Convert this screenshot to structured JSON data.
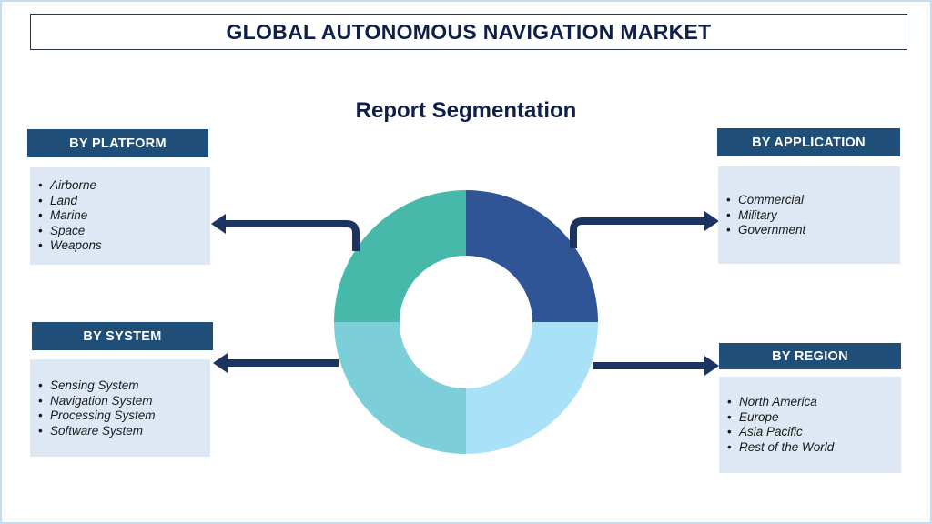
{
  "title": "GLOBAL AUTONOMOUS NAVIGATION MARKET",
  "subtitle": "Report Segmentation",
  "colors": {
    "header_bg": "#1f4e79",
    "box_bg": "#dde8f4",
    "arrow": "#1c3461",
    "title_text": "#0f1f4a",
    "donut": [
      "#2f5597",
      "#a9e1f8",
      "#7ccfd9",
      "#47b9aa"
    ]
  },
  "segments": {
    "platform": {
      "header": "BY PLATFORM",
      "items": [
        "Airborne",
        "Land",
        "Marine",
        "Space",
        "Weapons"
      ]
    },
    "application": {
      "header": "BY APPLICATION",
      "items": [
        "Commercial",
        "Military",
        "Government"
      ]
    },
    "system": {
      "header": "BY SYSTEM",
      "items": [
        "Sensing System",
        "Navigation System",
        "Processing System",
        "Software System"
      ]
    },
    "region": {
      "header": "BY REGION",
      "items": [
        "North America",
        "Europe",
        "Asia Pacific",
        "Rest of the World"
      ]
    }
  }
}
